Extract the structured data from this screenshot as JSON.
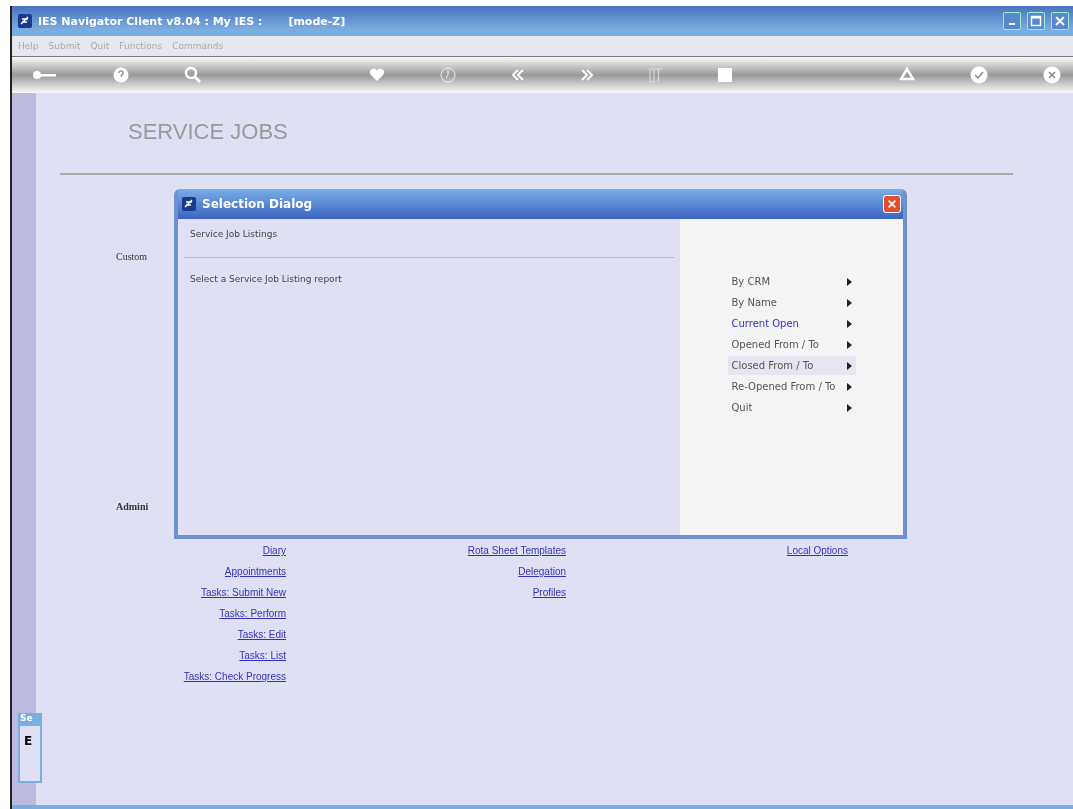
{
  "window": {
    "title": "IES Navigator Client v8.04 : My IES :",
    "mode": "[mode-Z]"
  },
  "menu_bar": [
    "Help",
    "Submit",
    "Quit",
    "Functions",
    "Commands"
  ],
  "page": {
    "heading": "SERVICE JOBS",
    "section_labels": [
      "Custom",
      "Admini"
    ],
    "link_columns": [
      [
        "Diary",
        "Appointments",
        "Tasks: Submit New",
        "Tasks: Perform",
        "Tasks: Edit",
        "Tasks: List",
        "Tasks: Check Progress"
      ],
      [
        "Rota Sheet Templates",
        "Delegation",
        "Profiles"
      ],
      [
        "Local Options"
      ]
    ]
  },
  "side_panel": {
    "title": "Se",
    "text": "E"
  },
  "dialog": {
    "title": "Selection Dialog",
    "heading": "Service Job Listings",
    "prompt": "Select a Service Job Listing report",
    "options": [
      {
        "label": "By CRM",
        "selected": false,
        "hovered": false
      },
      {
        "label": "By Name",
        "selected": false,
        "hovered": false
      },
      {
        "label": "Current Open",
        "selected": false,
        "hovered": true
      },
      {
        "label": "Opened From / To",
        "selected": false,
        "hovered": false
      },
      {
        "label": "Closed From / To",
        "selected": true,
        "hovered": false
      },
      {
        "label": "Re-Opened From / To",
        "selected": false,
        "hovered": false
      },
      {
        "label": "Quit",
        "selected": false,
        "hovered": false
      }
    ]
  }
}
